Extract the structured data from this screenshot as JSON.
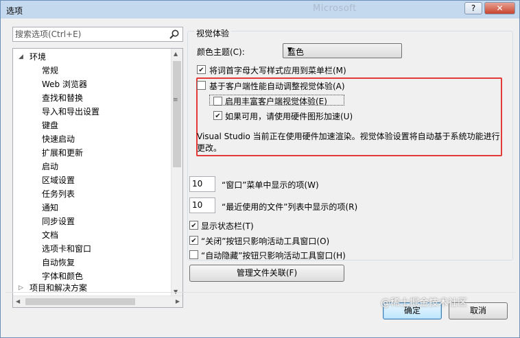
{
  "window": {
    "title": "选项",
    "ghost_title": "Microsoft",
    "help_label": "?",
    "close_label": "✕"
  },
  "search": {
    "placeholder": "搜索选项(Ctrl+E)"
  },
  "tree": {
    "root_label": "环境",
    "items": [
      "常规",
      "Web 浏览器",
      "查找和替换",
      "导入和导出设置",
      "键盘",
      "快速启动",
      "扩展和更新",
      "启动",
      "区域设置",
      "任务列表",
      "通知",
      "同步设置",
      "文档",
      "选项卡和窗口",
      "自动恢复",
      "字体和颜色"
    ],
    "next_root_label": "项目和解决方案"
  },
  "visual": {
    "group_title": "视觉体验",
    "color_theme_label": "颜色主题(C):",
    "color_theme_value": "蓝色",
    "uppercase_menu_label": "将词首字母大写样式应用到菜单栏(M)",
    "uppercase_menu_checked": true,
    "auto_adjust_label": "基于客户端性能自动调整视觉体验(A)",
    "auto_adjust_checked": false,
    "rich_client_label": "启用丰富客户端视觉体验(E)",
    "rich_client_checked": false,
    "hw_accel_label": "如果可用，请使用硬件图形加速(U)",
    "hw_accel_checked": true,
    "info_line1": "Visual Studio 当前正在使用硬件加速渲染。视觉体验设置将自动基于系统功能进行",
    "info_line2": "更改。"
  },
  "window_menu": {
    "value": "10",
    "label": "“窗口”菜单中显示的项(W)"
  },
  "recent_files": {
    "value": "10",
    "label": "“最近使用的文件”列表中显示的项(R)"
  },
  "checkboxes": {
    "status_bar_label": "显示状态栏(T)",
    "status_bar_checked": true,
    "close_btn_label": "“关闭”按钮只影响活动工具窗口(O)",
    "close_btn_checked": true,
    "autohide_label": "“自动隐藏”按钮只影响活动工具窗口(H)",
    "autohide_checked": false
  },
  "buttons": {
    "file_assoc": "管理文件关联(F)",
    "ok": "确定",
    "cancel": "取消"
  },
  "watermark": "@稀土掘金技术社区",
  "colors": {
    "highlight_box": "#e53935",
    "titlebar": "#c4d8ee"
  }
}
